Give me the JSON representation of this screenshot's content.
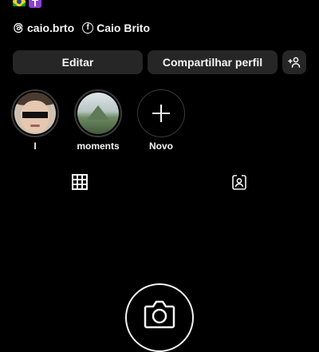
{
  "profile": {
    "bio_emojis": [
      "brazil-flag",
      "latin-cross"
    ],
    "links": [
      {
        "icon": "threads-icon",
        "label": "caio.brto"
      },
      {
        "icon": "facebook-icon",
        "label": "Caio Brito"
      }
    ]
  },
  "actions": {
    "edit_label": "Editar",
    "share_label": "Compartilhar perfil",
    "add_user_icon": "add-person-icon"
  },
  "highlights": [
    {
      "label": "I"
    },
    {
      "label": "moments"
    },
    {
      "label": "Novo"
    }
  ],
  "tabs": [
    {
      "icon": "grid-icon",
      "active": true
    },
    {
      "icon": "tagged-icon",
      "active": false
    }
  ],
  "empty_state": {
    "icon": "camera-icon"
  },
  "colors": {
    "background": "#000000",
    "button": "#262626",
    "text": "#f5f5f5",
    "ring": "#3a3a3a"
  }
}
